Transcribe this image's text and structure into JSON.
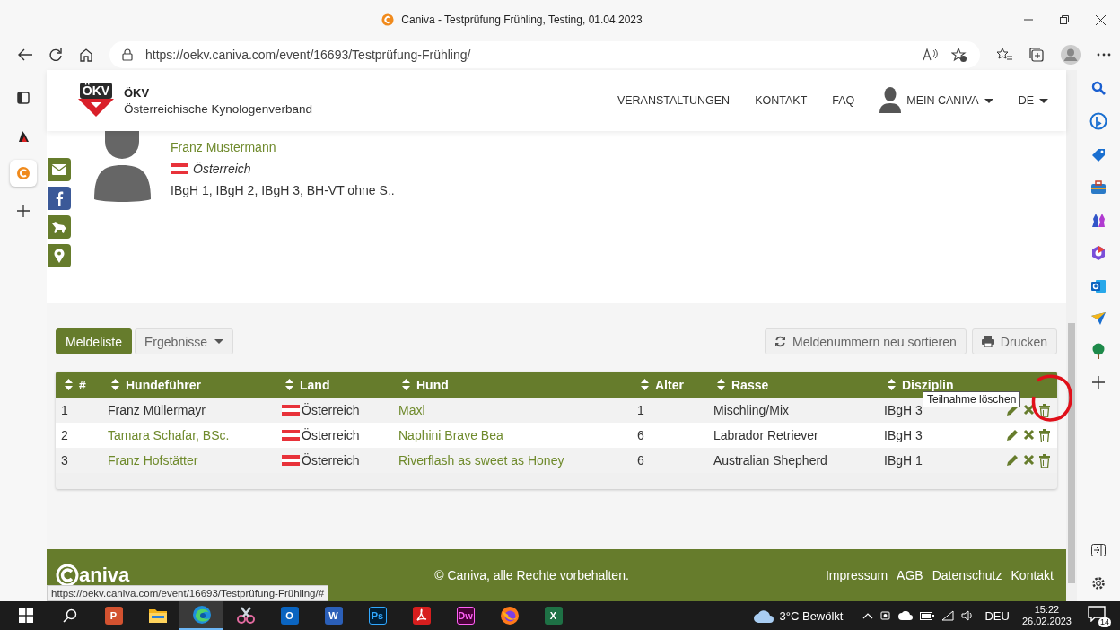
{
  "browser": {
    "title": "Caniva - Testprüfung Frühling, Testing, 01.04.2023",
    "url": "https://oekv.caniva.com/event/16693/Testprüfung-Frühling/"
  },
  "left_sidebar": [
    {
      "kind": "tabs",
      "selected": false
    },
    {
      "kind": "app",
      "selected": false
    },
    {
      "kind": "caniva",
      "selected": true
    },
    {
      "kind": "add",
      "selected": false
    }
  ],
  "right_sidebar": [
    {
      "kind": "search"
    },
    {
      "kind": "bing"
    },
    {
      "kind": "tag"
    },
    {
      "kind": "briefcase"
    },
    {
      "kind": "chess"
    },
    {
      "kind": "office"
    },
    {
      "kind": "outlook"
    },
    {
      "kind": "send"
    },
    {
      "kind": "tree"
    },
    {
      "kind": "add"
    }
  ],
  "site_header": {
    "logo_text": "ÖKV",
    "org_abbr": "ÖKV",
    "org_name": "Österreichische Kynologenverband",
    "nav": [
      "VERANSTALTUNGEN",
      "KONTAKT",
      "FAQ"
    ],
    "account": "MEIN CANIVA",
    "language": "DE"
  },
  "social_buttons": [
    {
      "kind": "mail"
    },
    {
      "kind": "facebook"
    },
    {
      "kind": "dog"
    },
    {
      "kind": "location"
    }
  ],
  "profile": {
    "name": "Franz Mustermann",
    "country": "Österreich",
    "disciplines": "IBgH 1, IBgH 2, IBgH 3, BH-VT ohne S.."
  },
  "tabs": [
    {
      "label": "Meldeliste",
      "selected": true,
      "has_menu": false
    },
    {
      "label": "Ergebnisse",
      "selected": false,
      "has_menu": true
    }
  ],
  "actions": [
    {
      "kind": "refresh",
      "label": "Meldenummern neu sortieren"
    },
    {
      "kind": "print",
      "label": "Drucken"
    }
  ],
  "table": {
    "columns": [
      "#",
      "Hundeführer",
      "Land",
      "Hund",
      "Alter",
      "Rasse",
      "Disziplin"
    ],
    "rows": [
      {
        "number": "1",
        "handler": "Franz Müllermayr",
        "handler_linked": false,
        "country": "Österreich",
        "dog": "Maxl",
        "age": "1",
        "breed": "Mischling/Mix",
        "discipline": "IBgH 3"
      },
      {
        "number": "2",
        "handler": "Tamara Schafar, BSc.",
        "handler_linked": true,
        "country": "Österreich",
        "dog": "Naphini Brave Bea",
        "age": "6",
        "breed": "Labrador Retriever",
        "discipline": "IBgH 3"
      },
      {
        "number": "3",
        "handler": "Franz Hofstätter",
        "handler_linked": true,
        "country": "Österreich",
        "dog": "Riverflash as sweet as Honey",
        "age": "6",
        "breed": "Australian Shepherd",
        "discipline": "IBgH 1"
      }
    ]
  },
  "tooltip": "Teilnahme löschen",
  "footer": {
    "brand": "aniva",
    "copyright": "© Caniva, alle Rechte vorbehalten.",
    "links": [
      "Impressum",
      "AGB",
      "Datenschutz",
      "Kontakt"
    ]
  },
  "status_url": "https://oekv.caniva.com/event/16693/Testprüfung-Frühling/#",
  "taskbar": {
    "apps": [
      {
        "kind": "start",
        "selected": false
      },
      {
        "kind": "search",
        "selected": false
      },
      {
        "kind": "powerpoint",
        "label": "P",
        "selected": false
      },
      {
        "kind": "files",
        "selected": false
      },
      {
        "kind": "edge",
        "selected": true
      },
      {
        "kind": "snip",
        "selected": false
      },
      {
        "kind": "outlook",
        "label": "O",
        "selected": false
      },
      {
        "kind": "word",
        "label": "W",
        "selected": false
      },
      {
        "kind": "photoshop",
        "label": "Ps",
        "selected": false
      },
      {
        "kind": "acrobat",
        "selected": false
      },
      {
        "kind": "dreamweaver",
        "label": "Dw",
        "selected": false
      },
      {
        "kind": "firefox",
        "selected": false
      },
      {
        "kind": "excel",
        "label": "X",
        "selected": false
      }
    ],
    "weather": "3°C Bewölkt",
    "language": "DEU",
    "time": "15:22",
    "date": "26.02.2023",
    "notifications": "14"
  }
}
